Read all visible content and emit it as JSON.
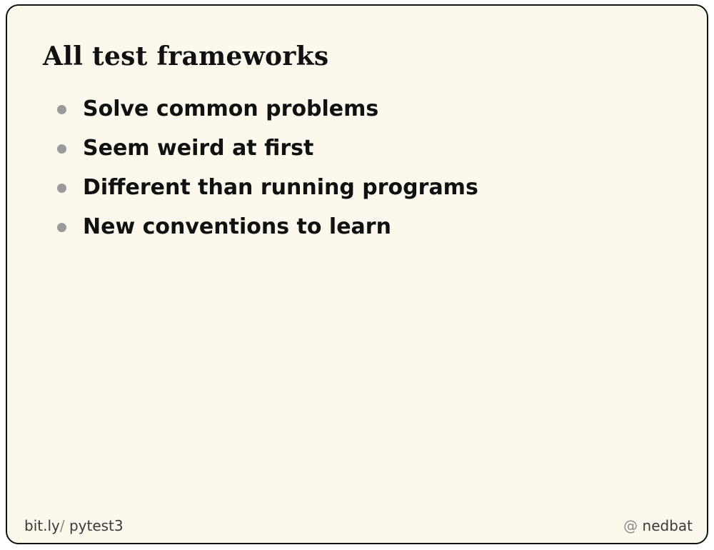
{
  "slide": {
    "title": "All test frameworks",
    "bullets": [
      "Solve common problems",
      "Seem weird at first",
      "Different than running programs",
      "New conventions to learn"
    ],
    "footer_left": {
      "domain": "bit.ly",
      "separator": "/",
      "path": "pytest3"
    },
    "footer_right": {
      "at_sign": "@",
      "handle": "nedbat"
    }
  },
  "colors": {
    "background": "#fdf8ec",
    "border": "#111111",
    "text": "#111111",
    "bullet": "#9a9a9a",
    "footer_text": "#3a3a3a",
    "footer_accent": "#8a8a8a"
  }
}
